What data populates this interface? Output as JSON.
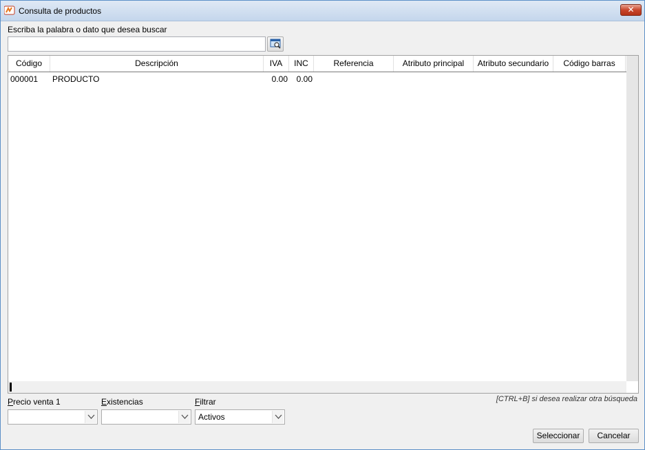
{
  "window": {
    "title": "Consulta de productos",
    "close_glyph": "✕"
  },
  "search": {
    "label": "Escriba la palabra o dato que desea buscar",
    "value": "",
    "button_icon": "search-icon"
  },
  "table": {
    "columns": [
      "Código",
      "Descripción",
      "IVA",
      "INC",
      "Referencia",
      "Atributo principal",
      "Atributo secundario",
      "Código barras"
    ],
    "rows": [
      {
        "codigo": "000001",
        "descripcion": "PRODUCTO",
        "iva": "0.00",
        "inc": "0.00",
        "referencia": "",
        "atributo_principal": "",
        "atributo_secundario": "",
        "codigo_barras": ""
      }
    ]
  },
  "hint": "[CTRL+B] si desea realizar otra búsqueda",
  "filters": {
    "precio": {
      "label_first": "P",
      "label_rest": "recio venta 1",
      "value": ""
    },
    "existencias": {
      "label_first": "E",
      "label_rest": "xistencias",
      "value": ""
    },
    "filtrar": {
      "label_first": "F",
      "label_rest": "iltrar",
      "value": "Activos"
    }
  },
  "buttons": {
    "select": "Seleccionar",
    "cancel": "Cancelar"
  },
  "colors": {
    "title_bar": "#c4d6ec",
    "close_button": "#c9462c",
    "window_bg": "#f0f0f0"
  }
}
